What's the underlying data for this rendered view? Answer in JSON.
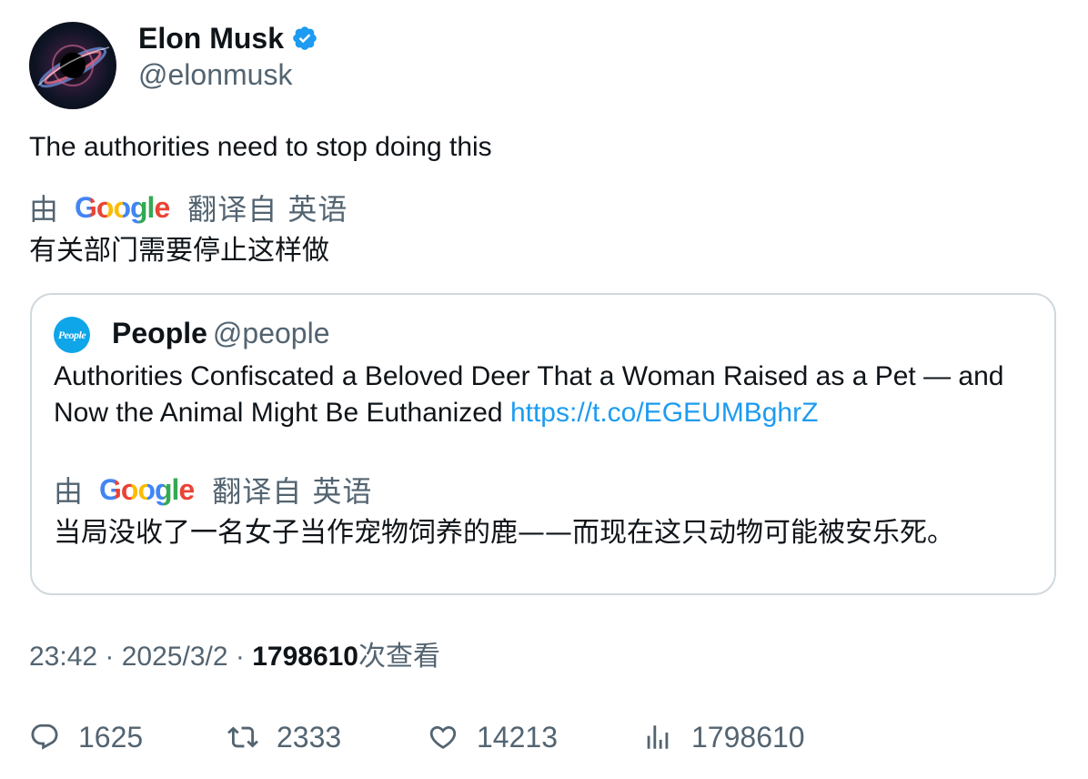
{
  "author": {
    "name": "Elon Musk",
    "handle": "@elonmusk",
    "verified": true
  },
  "tweet": {
    "text": "The authorities need to stop doing this",
    "translation": {
      "by": "由",
      "provider": "Google",
      "from": "翻译自 英语",
      "text": "有关部门需要停止这样做"
    }
  },
  "quote": {
    "logo_text": "People",
    "name": "People",
    "handle": "@people",
    "text": "Authorities Confiscated a Beloved Deer That a Woman Raised as a Pet — and Now the Animal Might Be Euthanized ",
    "link": "https://t.co/EGEUMBghrZ",
    "translation": {
      "by": "由",
      "provider": "Google",
      "from": "翻译自 英语",
      "text": "当局没收了一名女子当作宠物饲养的鹿——而现在这只动物可能被安乐死。"
    }
  },
  "meta": {
    "time": "23:42",
    "sep1": " · ",
    "date": "2025/3/2",
    "sep2": " · ",
    "views": "1798610",
    "views_label": "次查看"
  },
  "stats": {
    "replies": "1625",
    "retweets": "2333",
    "likes": "14213",
    "views": "1798610"
  },
  "colors": {
    "verified": "#1d9bf0",
    "link": "#1d9bf0",
    "secondary_text": "#536471",
    "border": "#cfd9de",
    "people_logo": "#0ea5e9"
  },
  "icons": [
    "verified-badge-icon",
    "google-logo",
    "reply-icon",
    "retweet-icon",
    "like-icon",
    "views-icon"
  ]
}
